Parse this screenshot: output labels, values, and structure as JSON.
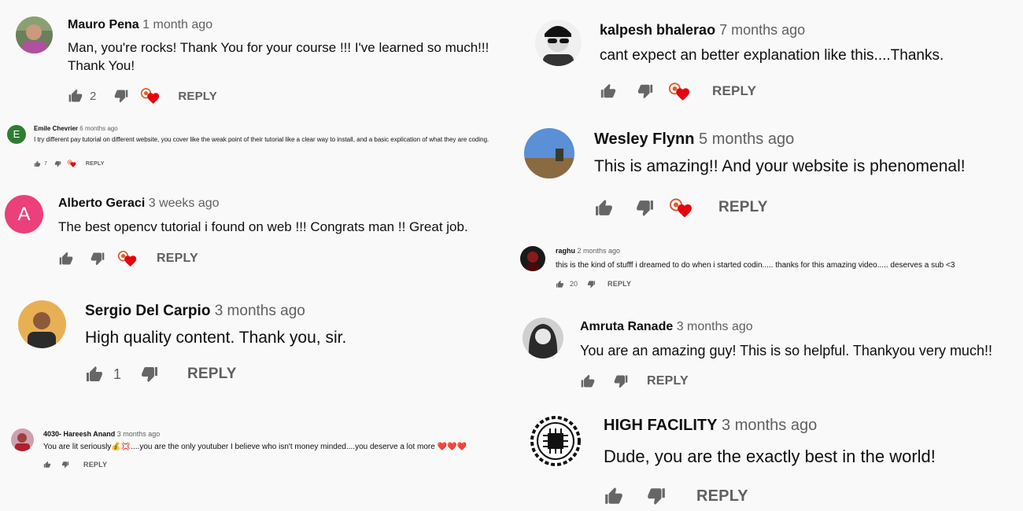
{
  "colors": {
    "background": "#f9f9f9",
    "text": "#0f0f0f",
    "muted": "#606060",
    "heart": "#e4050e",
    "icon": "#666666"
  },
  "comments_left": [
    {
      "author": "Mauro Pena",
      "time": "1 month ago",
      "text": "Man, you're rocks! Thank You for your course !!! I've learned so much!!! Thank You!",
      "likes": "2",
      "reply": "REPLY",
      "avatar": "photo"
    },
    {
      "author": "Emile Chevrier",
      "time": "6 months ago",
      "text": "I try different pay tutorial on different website, you cover like the weak point of their tutorial like a clear way to install, and a basic explication of what they are coding.",
      "likes": "7",
      "reply": "REPLY",
      "avatar_letter": "E"
    },
    {
      "author": "Alberto Geraci",
      "time": "3 weeks ago",
      "text": "The best opencv tutorial i found on web !!! Congrats man !! Great job.",
      "likes": "",
      "reply": "REPLY",
      "avatar_letter": "A"
    },
    {
      "author": "Sergio Del Carpio",
      "time": "3 months ago",
      "text": "High quality content. Thank you, sir.",
      "likes": "1",
      "reply": "REPLY",
      "avatar": "photo"
    },
    {
      "author": "4030- Hareesh Anand",
      "time": "3 months ago",
      "text": "You are lit seriously💰💢....you are the only youtuber I believe who isn't money minded....you deserve a lot more ❤️❤️❤️",
      "likes": "",
      "reply": "REPLY",
      "avatar": "photo"
    }
  ],
  "comments_right": [
    {
      "author": "kalpesh bhalerao",
      "time": "7 months ago",
      "text": "cant expect an better explanation like this....Thanks.",
      "likes": "",
      "reply": "REPLY",
      "avatar": "photo"
    },
    {
      "author": "Wesley Flynn",
      "time": "5 months ago",
      "text": "This is amazing!! And your website is phenomenal!",
      "likes": "",
      "reply": "REPLY",
      "avatar": "landscape"
    },
    {
      "author": "raghu",
      "time": "2 months ago",
      "text": "this is the kind of stufff i dreamed to do when i started codin..... thanks for this amazing video..... deserves a sub <3",
      "likes": "20",
      "reply": "REPLY",
      "avatar": "photo"
    },
    {
      "author": "Amruta Ranade",
      "time": "3 months ago",
      "text": "You are an amazing guy! This is so helpful. Thankyou very much!!",
      "likes": "",
      "reply": "REPLY",
      "avatar": "photo"
    },
    {
      "author": "HIGH FACILITY",
      "time": "3 months ago",
      "text": "Dude, you are the exactly best in the world!",
      "likes": "",
      "reply": "REPLY",
      "avatar": "chip-logo"
    }
  ]
}
